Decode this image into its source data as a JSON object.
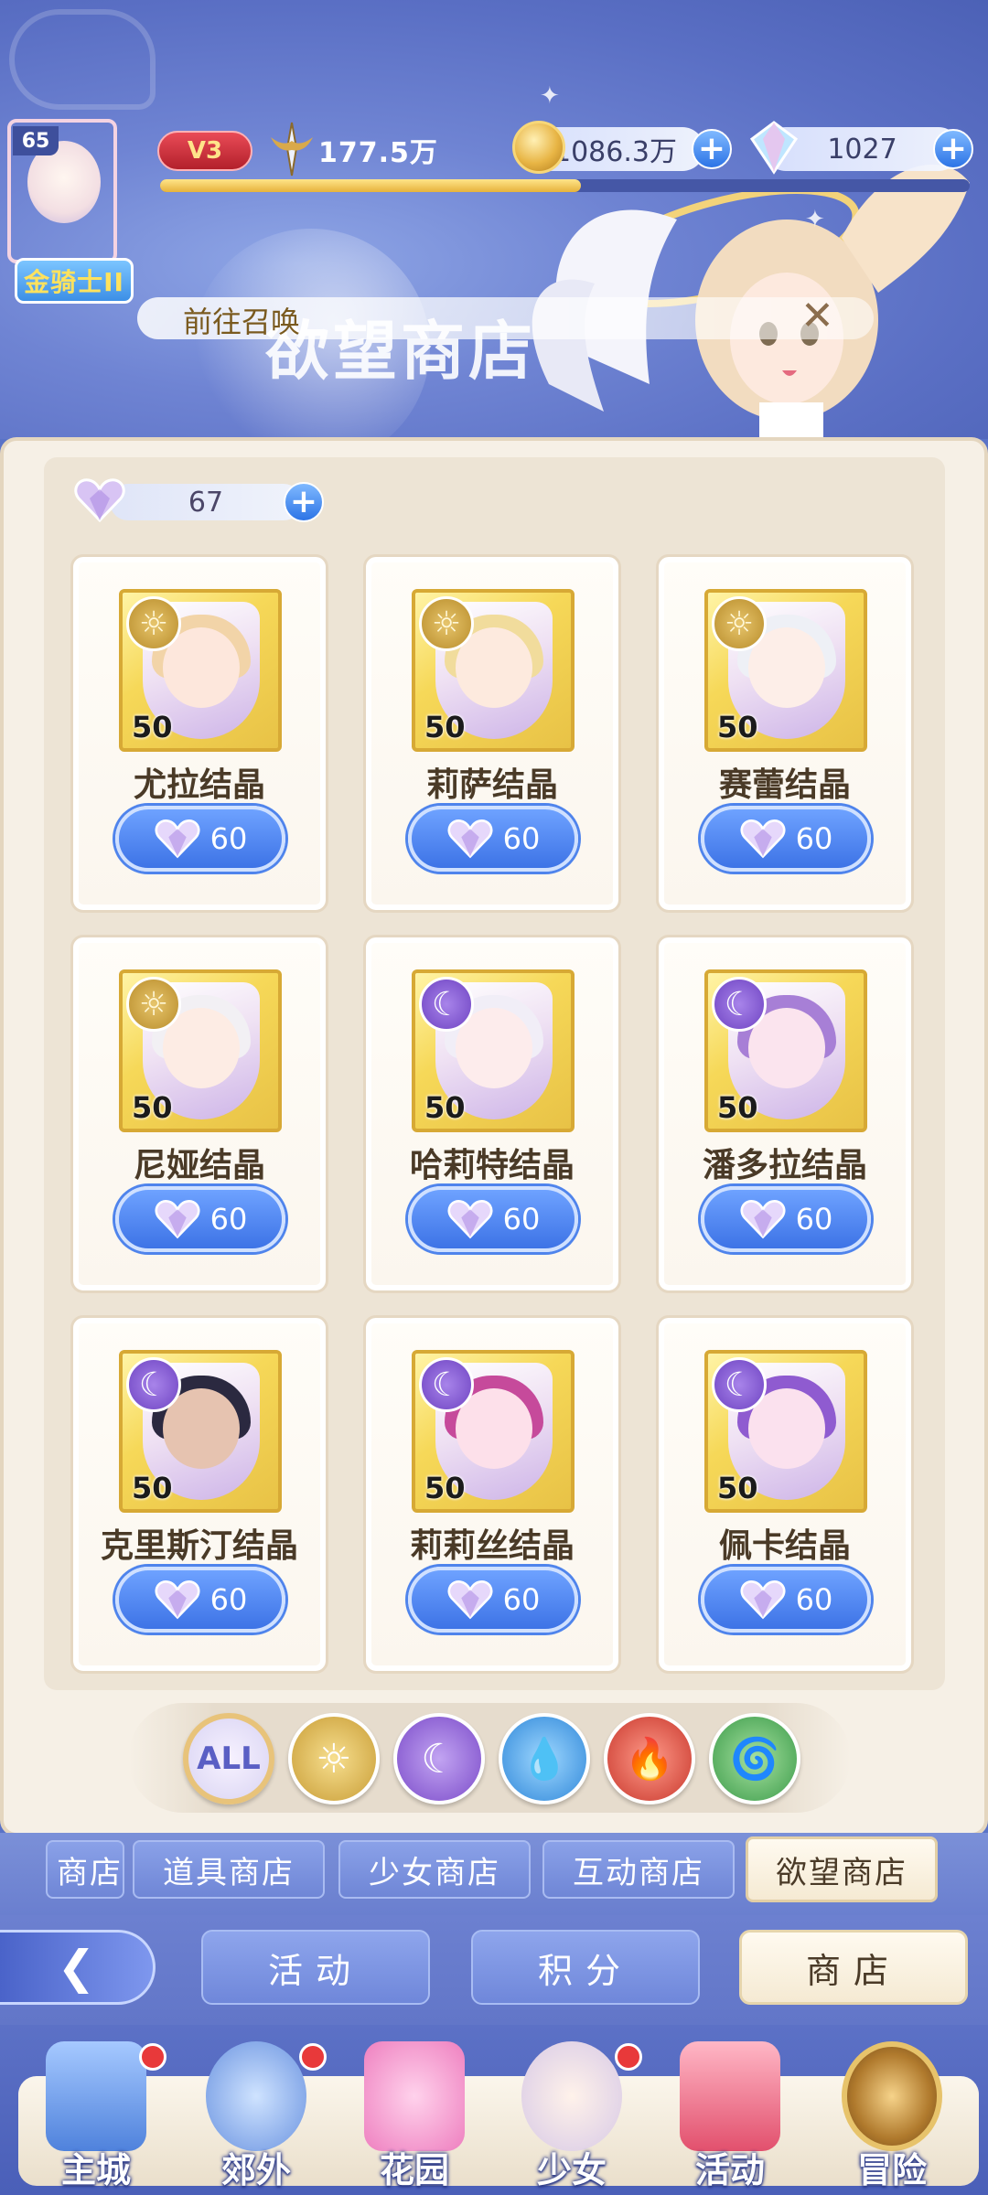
{
  "status": {
    "level": "65",
    "rank": "金骑士II",
    "vip": "V3",
    "power": "177.5万",
    "gold": "1086.3万",
    "gems": "1027",
    "exp_fraction": 0.52
  },
  "banner": {
    "summon_text": "前往召唤",
    "shop_title": "欲望商店"
  },
  "shop": {
    "currency": "67",
    "items": [
      {
        "name": "尤拉结晶",
        "qty": "50",
        "price": "60",
        "element": "sun-icon"
      },
      {
        "name": "莉萨结晶",
        "qty": "50",
        "price": "60",
        "element": "sun-icon"
      },
      {
        "name": "赛蕾结晶",
        "qty": "50",
        "price": "60",
        "element": "sun-icon"
      },
      {
        "name": "尼娅结晶",
        "qty": "50",
        "price": "60",
        "element": "sun-icon"
      },
      {
        "name": "哈莉特结晶",
        "qty": "50",
        "price": "60",
        "element": "moon-icon"
      },
      {
        "name": "潘多拉结晶",
        "qty": "50",
        "price": "60",
        "element": "moon-icon"
      },
      {
        "name": "克里斯汀结晶",
        "qty": "50",
        "price": "60",
        "element": "moon-icon"
      },
      {
        "name": "莉莉丝结晶",
        "qty": "50",
        "price": "60",
        "element": "moon-icon"
      },
      {
        "name": "佩卡结晶",
        "qty": "50",
        "price": "60",
        "element": "moon-icon"
      }
    ]
  },
  "filters": {
    "all_label": "ALL"
  },
  "tabs": [
    "商店",
    "道具商店",
    "少女商店",
    "互动商店",
    "欲望商店"
  ],
  "nav": {
    "activity": "活动",
    "points": "积分",
    "shop": "商店"
  },
  "bottom_nav": [
    "主城",
    "郊外",
    "花园",
    "少女",
    "活动",
    "冒险"
  ],
  "colors": {
    "accent_blue": "#3d73e6",
    "gold": "#d7a935",
    "panel_bg": "#f6f0e6"
  }
}
